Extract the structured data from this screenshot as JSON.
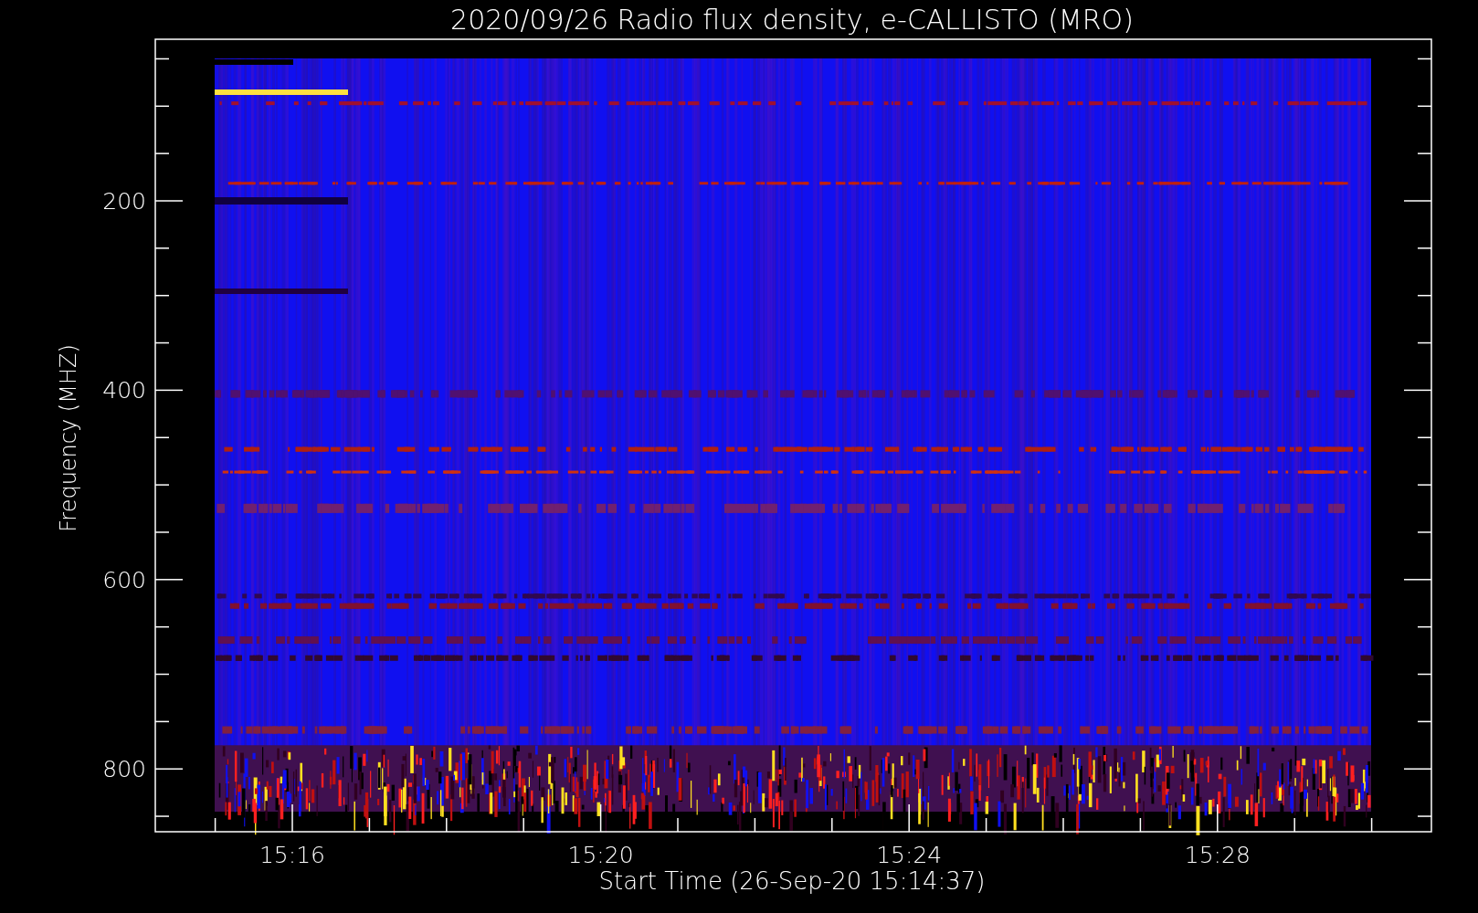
{
  "title": "2020/09/26  Radio flux density, e-CALLISTO (MRO)",
  "y_axis": {
    "label": "Frequency (MHZ)",
    "ticks": [
      "200",
      "400",
      "600",
      "800"
    ]
  },
  "x_axis": {
    "label": "Start Time (26-Sep-20 15:14:37)",
    "ticks": [
      "15:16",
      "15:20",
      "15:24",
      "15:28"
    ]
  }
}
